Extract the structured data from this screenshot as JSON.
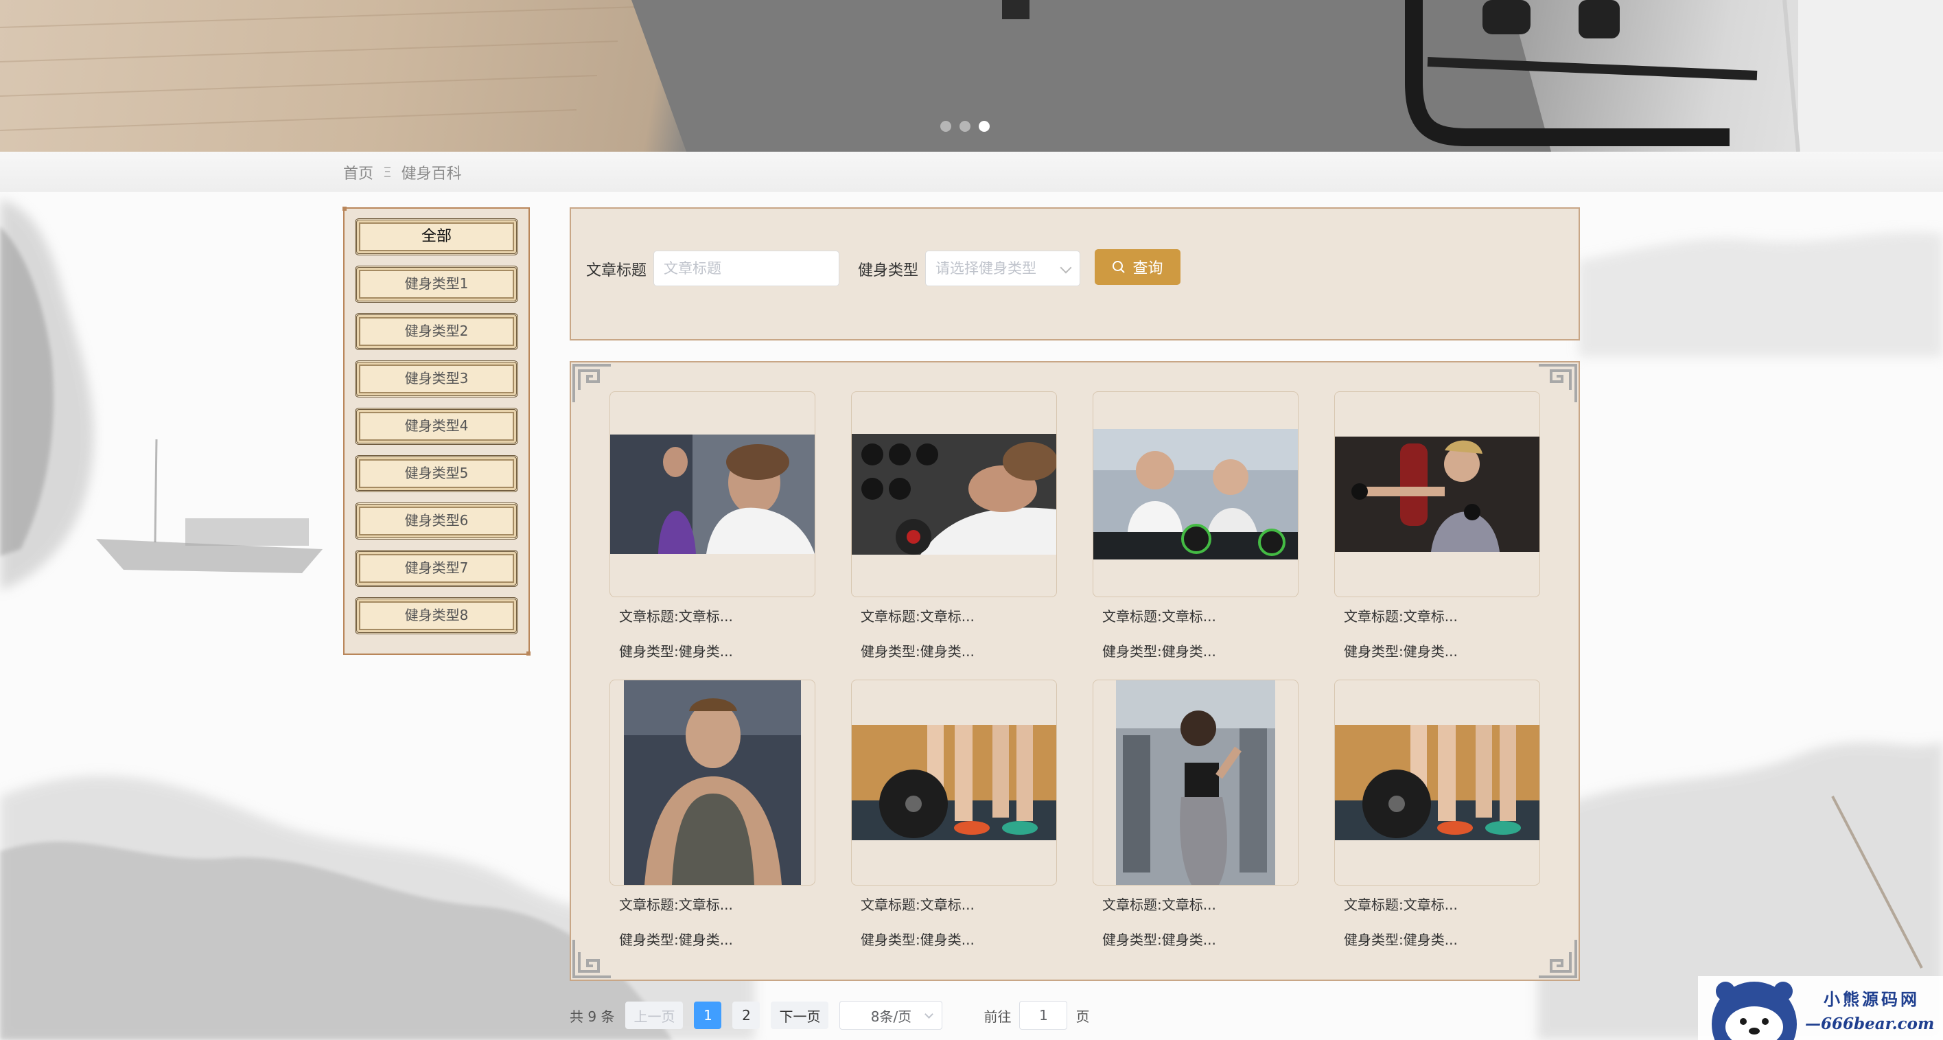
{
  "breadcrumb": {
    "home": "首页",
    "separator": "Ξ",
    "current": "健身百科"
  },
  "banner": {
    "slides": 3,
    "active_slide": 3
  },
  "sidebar": {
    "items": [
      {
        "label": "全部",
        "active": true
      },
      {
        "label": "健身类型1"
      },
      {
        "label": "健身类型2"
      },
      {
        "label": "健身类型3"
      },
      {
        "label": "健身类型4"
      },
      {
        "label": "健身类型5"
      },
      {
        "label": "健身类型6"
      },
      {
        "label": "健身类型7"
      },
      {
        "label": "健身类型8"
      }
    ]
  },
  "search": {
    "title_label": "文章标题",
    "title_placeholder": "文章标题",
    "type_label": "健身类型",
    "type_placeholder": "请选择健身类型",
    "query_button": "查询",
    "query_icon": "search-icon"
  },
  "articles": [
    {
      "title": "文章标题:文章标...",
      "type": "健身类型:健身类..."
    },
    {
      "title": "文章标题:文章标...",
      "type": "健身类型:健身类..."
    },
    {
      "title": "文章标题:文章标...",
      "type": "健身类型:健身类..."
    },
    {
      "title": "文章标题:文章标...",
      "type": "健身类型:健身类..."
    },
    {
      "title": "文章标题:文章标...",
      "type": "健身类型:健身类..."
    },
    {
      "title": "文章标题:文章标...",
      "type": "健身类型:健身类..."
    },
    {
      "title": "文章标题:文章标...",
      "type": "健身类型:健身类..."
    },
    {
      "title": "文章标题:文章标...",
      "type": "健身类型:健身类..."
    }
  ],
  "pagination": {
    "total": "共 9 条",
    "prev": "上一页",
    "pages": [
      "1",
      "2"
    ],
    "current_page": "1",
    "next": "下一页",
    "page_size": "8条/页",
    "goto_label": "前往",
    "goto_value": "1",
    "goto_suffix": "页"
  },
  "watermark": {
    "line1": "小熊源码网",
    "line2": "—666bear.com—"
  },
  "colors": {
    "accent": "#cf9a41",
    "panel": "#ede4d9",
    "border": "#c8a686",
    "page_active": "#409eff",
    "brand": "#1f3f8f"
  }
}
